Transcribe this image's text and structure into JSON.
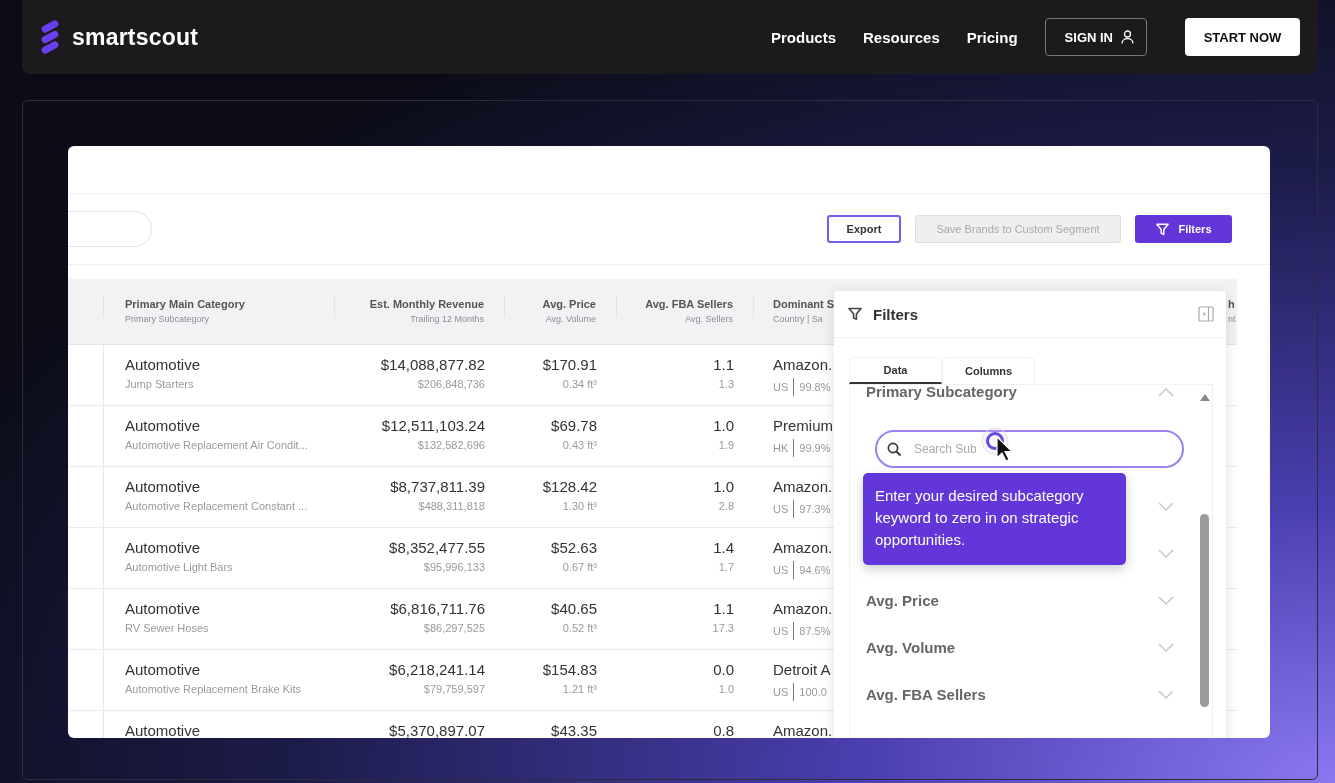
{
  "nav": {
    "brand": "smartscout",
    "links": [
      "Products",
      "Resources",
      "Pricing"
    ],
    "sign_in": "SIGN IN",
    "start": "START NOW"
  },
  "toolbar": {
    "buttons": [
      {
        "label": "Export",
        "kind": "outline",
        "disabled": false
      },
      {
        "label": "Save Brands to Custom Segment",
        "kind": "plain",
        "disabled": true
      },
      {
        "label": "Filters",
        "kind": "primary",
        "disabled": false
      }
    ]
  },
  "table": {
    "columns": [
      {
        "title": "Primary Main Category",
        "subtitle": "Primary Subcategory"
      },
      {
        "title": "Est. Monthly Revenue",
        "subtitle": "Trailing 12 Months"
      },
      {
        "title": "Avg. Price",
        "subtitle": "Avg. Volume"
      },
      {
        "title": "Avg. FBA Sellers",
        "subtitle": "Avg. Sellers"
      },
      {
        "title": "Dominant S",
        "subtitle": "Country  |  Sa"
      },
      {
        "title": "h",
        "subtitle": "nt"
      }
    ],
    "rows": [
      {
        "category": "Automotive",
        "subcategory": "Jump Starters",
        "revenue": "$14,088,877.82",
        "revenue_sub": "$206,848,736",
        "price": "$170.91",
        "volume": "0.34 ft³",
        "fba_sellers": "1.1",
        "sellers": "1.3",
        "seller": "Amazon.",
        "country": "US",
        "share": "99.8%"
      },
      {
        "category": "Automotive",
        "subcategory": "Automotive Replacement Air Condit...",
        "revenue": "$12,511,103.24",
        "revenue_sub": "$132,582,696",
        "price": "$69.78",
        "volume": "0.43 ft³",
        "fba_sellers": "1.0",
        "sellers": "1.9",
        "seller": "Premium",
        "country": "HK",
        "share": "99.9%"
      },
      {
        "category": "Automotive",
        "subcategory": "Automotive Replacement Constant ...",
        "revenue": "$8,737,811.39",
        "revenue_sub": "$488,311,818",
        "price": "$128.42",
        "volume": "1.30 ft³",
        "fba_sellers": "1.0",
        "sellers": "2.8",
        "seller": "Amazon.",
        "country": "US",
        "share": "97.3%"
      },
      {
        "category": "Automotive",
        "subcategory": "Automotive Light Bars",
        "revenue": "$8,352,477.55",
        "revenue_sub": "$95,996,133",
        "price": "$52.63",
        "volume": "0.67 ft³",
        "fba_sellers": "1.4",
        "sellers": "1.7",
        "seller": "Amazon.",
        "country": "US",
        "share": "94.6%"
      },
      {
        "category": "Automotive",
        "subcategory": "RV Sewer Hoses",
        "revenue": "$6,816,711.76",
        "revenue_sub": "$86,297,525",
        "price": "$40.65",
        "volume": "0.52 ft³",
        "fba_sellers": "1.1",
        "sellers": "17.3",
        "seller": "Amazon.",
        "country": "US",
        "share": "87.5%"
      },
      {
        "category": "Automotive",
        "subcategory": "Automotive Replacement Brake Kits",
        "revenue": "$6,218,241.14",
        "revenue_sub": "$79,759,597",
        "price": "$154.83",
        "volume": "1.21 ft³",
        "fba_sellers": "0.0",
        "sellers": "1.0",
        "seller": "Detroit A",
        "country": "US",
        "share": "100.0"
      },
      {
        "category": "Automotive",
        "revenue": "$5,370,897.07",
        "price": "$43.35",
        "fba_sellers": "0.8",
        "seller": "Amazon."
      }
    ]
  },
  "filters": {
    "title": "Filters",
    "tabs": [
      {
        "label": "Data",
        "selected": true
      },
      {
        "label": "Columns",
        "selected": false
      }
    ],
    "items": [
      {
        "label": "Primary Subcategory",
        "expanded": true,
        "search_placeholder": "Search Sub"
      },
      {
        "expanded": false
      },
      {
        "expanded": false
      },
      {
        "label": "Avg. Price",
        "expanded": false
      },
      {
        "label": "Avg. Volume",
        "expanded": false
      },
      {
        "label": "Avg. FBA Sellers",
        "expanded": false
      }
    ],
    "tooltip": "Enter your desired subcategory keyword to zero in on strategic opportunities."
  }
}
